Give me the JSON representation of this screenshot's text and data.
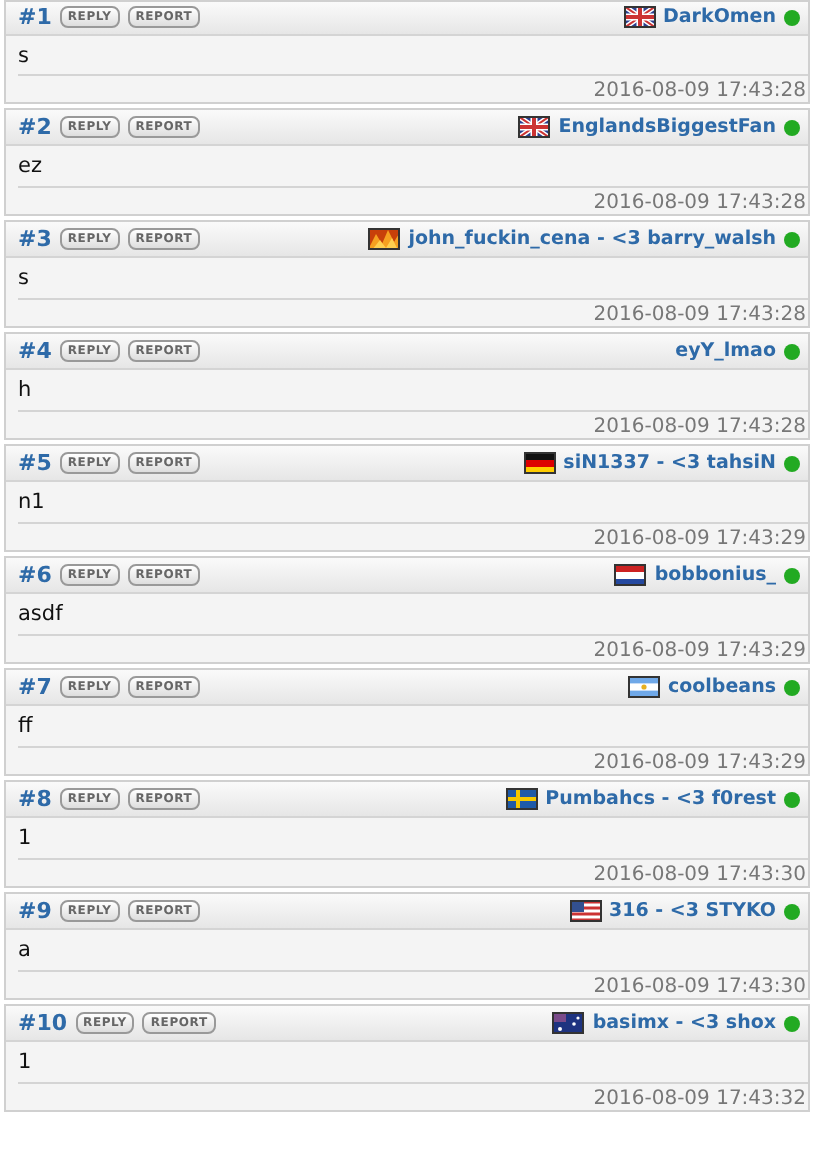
{
  "posts": [
    {
      "number": "#1",
      "reply": "REPLY",
      "report": "REPORT",
      "flag": {
        "kind": "gb"
      },
      "author": "DarkOmen",
      "online": true,
      "message": "s",
      "date": "2016-08-09 17:43:28"
    },
    {
      "number": "#2",
      "reply": "REPLY",
      "report": "REPORT",
      "flag": {
        "kind": "gb"
      },
      "author": "EnglandsBiggestFan",
      "online": true,
      "message": "ez",
      "date": "2016-08-09 17:43:28"
    },
    {
      "number": "#3",
      "reply": "REPLY",
      "report": "REPORT",
      "flag": {
        "kind": "fire"
      },
      "author": "john_fuckin_cena - <3 barry_walsh",
      "online": true,
      "message": "s",
      "date": "2016-08-09 17:43:28"
    },
    {
      "number": "#4",
      "reply": "REPLY",
      "report": "REPORT",
      "author": "eyY_lmao",
      "online": true,
      "message": "h",
      "date": "2016-08-09 17:43:28"
    },
    {
      "number": "#5",
      "reply": "REPLY",
      "report": "REPORT",
      "flag": {
        "kind": "de"
      },
      "author": "siN1337 - <3 tahsiN",
      "online": true,
      "message": "n1",
      "date": "2016-08-09 17:43:29"
    },
    {
      "number": "#6",
      "reply": "REPLY",
      "report": "REPORT",
      "flag": {
        "kind": "nl"
      },
      "author": "bobbonius_",
      "online": true,
      "message": "asdf",
      "date": "2016-08-09 17:43:29"
    },
    {
      "number": "#7",
      "reply": "REPLY",
      "report": "REPORT",
      "flag": {
        "kind": "ar"
      },
      "author": "coolbeans",
      "online": true,
      "message": "ff",
      "date": "2016-08-09 17:43:29"
    },
    {
      "number": "#8",
      "reply": "REPLY",
      "report": "REPORT",
      "flag": {
        "kind": "se"
      },
      "author": "Pumbahcs - <3 f0rest",
      "online": true,
      "message": "1",
      "date": "2016-08-09 17:43:30"
    },
    {
      "number": "#9",
      "reply": "REPLY",
      "report": "REPORT",
      "flag": {
        "kind": "us"
      },
      "author": "316 - <3 STYKO",
      "online": true,
      "message": "a",
      "date": "2016-08-09 17:43:30"
    },
    {
      "number": "#10",
      "reply": "REPLY",
      "report": "REPORT",
      "flag": {
        "kind": "au"
      },
      "author": "basimx - <3 shox",
      "online": true,
      "message": "1",
      "date": "2016-08-09 17:43:32"
    }
  ]
}
